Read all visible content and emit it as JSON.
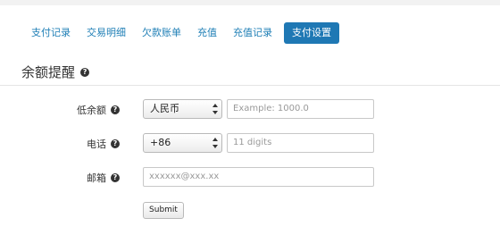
{
  "tabs": [
    {
      "label": "支付记录",
      "active": false
    },
    {
      "label": "交易明细",
      "active": false
    },
    {
      "label": "欠款账单",
      "active": false
    },
    {
      "label": "充值",
      "active": false
    },
    {
      "label": "充值记录",
      "active": false
    },
    {
      "label": "支付设置",
      "active": true
    }
  ],
  "section": {
    "title": "余额提醒",
    "help_icon": "question-circle-icon"
  },
  "form": {
    "balance": {
      "label": "低余额",
      "currency": "人民币",
      "amount_placeholder": "Example: 1000.0",
      "amount_value": ""
    },
    "phone": {
      "label": "电话",
      "country_code": "+86",
      "number_placeholder": "11 digits",
      "number_value": ""
    },
    "email": {
      "label": "邮箱",
      "placeholder": "xxxxxx@xxx.xx",
      "value": ""
    },
    "submit_label": "Submit"
  },
  "colors": {
    "accent": "#1f78b4",
    "tab_text": "#1f7fb6"
  }
}
